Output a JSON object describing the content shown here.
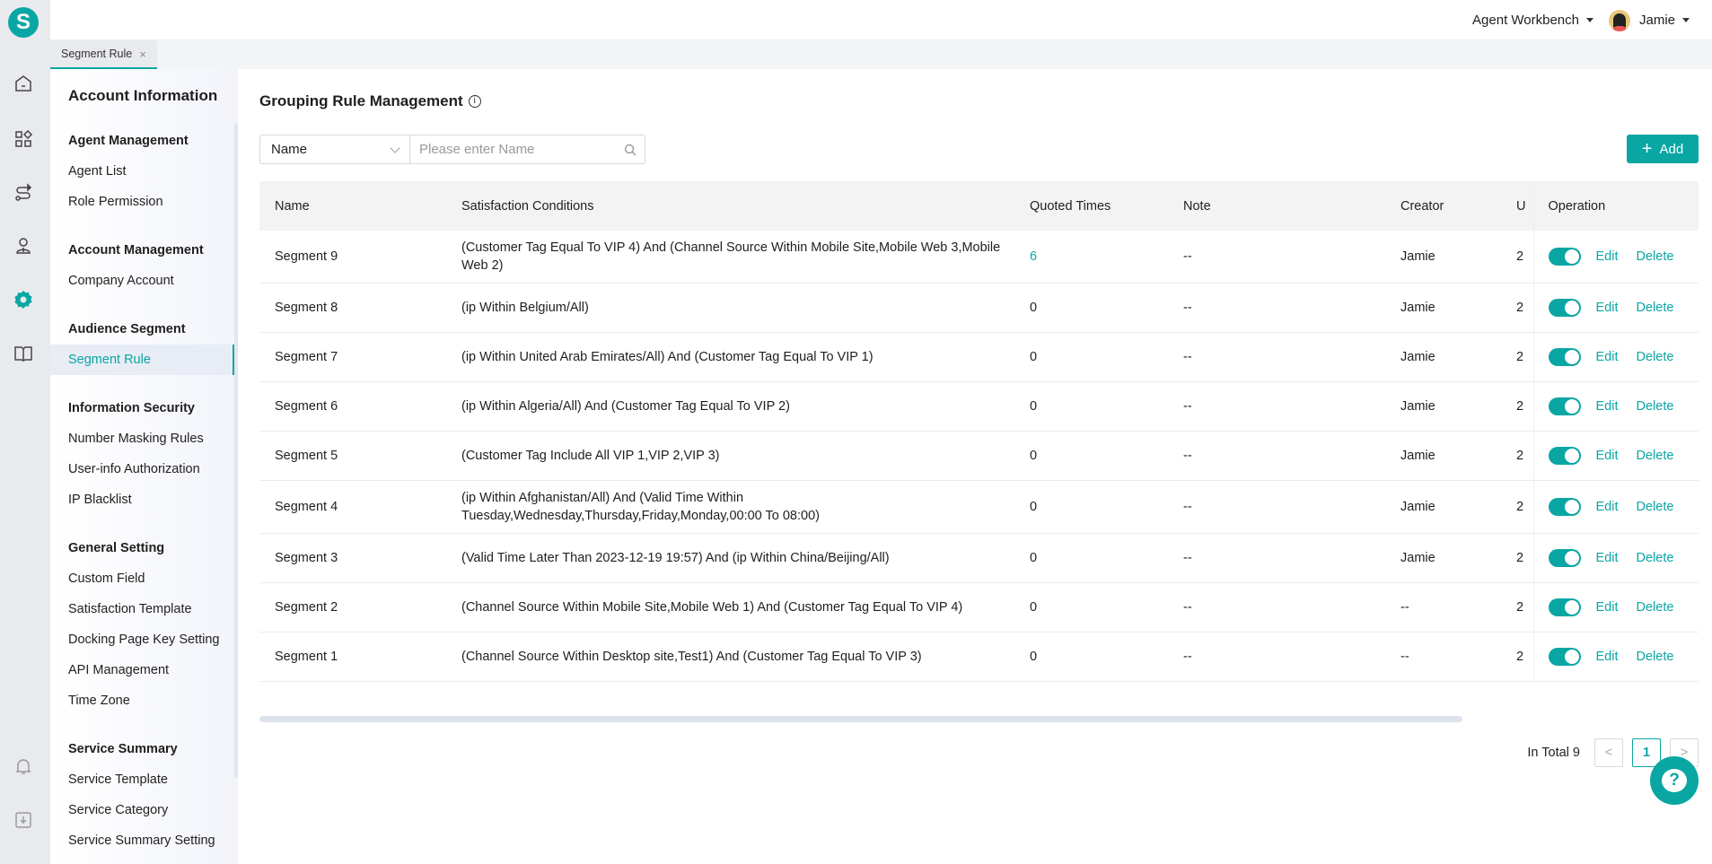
{
  "brand": {
    "logo_letter": "S",
    "accent": "#0aa6a3"
  },
  "rail": {
    "icons": [
      "home-icon",
      "apps-icon",
      "route-icon",
      "agent-icon",
      "settings-icon",
      "book-icon",
      "bell-icon",
      "download-icon"
    ],
    "active": "settings-icon"
  },
  "topbar": {
    "workbench": "Agent Workbench",
    "user": "Jamie"
  },
  "tabs": [
    {
      "label": "Segment Rule",
      "close": "×"
    }
  ],
  "sidebar": {
    "title": "Account Information",
    "groups": [
      {
        "label": "Agent Management",
        "items": [
          "Agent List",
          "Role Permission"
        ]
      },
      {
        "label": "Account Management",
        "items": [
          "Company Account"
        ]
      },
      {
        "label": "Audience Segment",
        "items": [
          "Segment Rule"
        ]
      },
      {
        "label": "Information Security",
        "items": [
          "Number Masking Rules",
          "User-info Authorization",
          "IP Blacklist"
        ]
      },
      {
        "label": "General Setting",
        "items": [
          "Custom Field",
          "Satisfaction Template",
          "Docking Page Key Setting",
          "API Management",
          "Time Zone"
        ]
      },
      {
        "label": "Service Summary",
        "items": [
          "Service Template",
          "Service Category",
          "Service Summary Setting"
        ]
      }
    ],
    "active_item": "Segment Rule"
  },
  "main": {
    "title": "Grouping Rule Management",
    "info": "i",
    "filter": {
      "field": "Name",
      "placeholder": "Please enter Name",
      "value": ""
    },
    "add_label": "Add",
    "columns": [
      "Name",
      "Satisfaction Conditions",
      "Quoted Times",
      "Note",
      "Creator",
      "U",
      "Operation"
    ],
    "rows": [
      {
        "name": "Segment 9",
        "cond": "(Customer Tag Equal To VIP 4) And (Channel Source Within Mobile Site,Mobile Web 3,Mobile Web 2)",
        "quoted": "6",
        "note": "--",
        "creator": "Jamie",
        "u": "2",
        "enabled": true
      },
      {
        "name": "Segment 8",
        "cond": "(ip Within Belgium/All)",
        "quoted": "0",
        "note": "--",
        "creator": "Jamie",
        "u": "2",
        "enabled": true
      },
      {
        "name": "Segment 7",
        "cond": "(ip Within United Arab Emirates/All) And (Customer Tag Equal To VIP 1)",
        "quoted": "0",
        "note": "--",
        "creator": "Jamie",
        "u": "2",
        "enabled": true
      },
      {
        "name": "Segment 6",
        "cond": "(ip Within Algeria/All) And (Customer Tag Equal To VIP 2)",
        "quoted": "0",
        "note": "--",
        "creator": "Jamie",
        "u": "2",
        "enabled": true
      },
      {
        "name": "Segment 5",
        "cond": "(Customer Tag Include All VIP 1,VIP 2,VIP 3)",
        "quoted": "0",
        "note": "--",
        "creator": "Jamie",
        "u": "2",
        "enabled": true
      },
      {
        "name": "Segment 4",
        "cond": "(ip Within Afghanistan/All) And (Valid Time Within Tuesday,Wednesday,Thursday,Friday,Monday,00:00 To 08:00)",
        "quoted": "0",
        "note": "--",
        "creator": "Jamie",
        "u": "2",
        "enabled": true
      },
      {
        "name": "Segment 3",
        "cond": "(Valid Time Later Than 2023-12-19 19:57) And (ip Within China/Beijing/All)",
        "quoted": "0",
        "note": "--",
        "creator": "Jamie",
        "u": "2",
        "enabled": true
      },
      {
        "name": "Segment 2",
        "cond": "(Channel Source Within Mobile Site,Mobile Web 1) And (Customer Tag Equal To VIP 4)",
        "quoted": "0",
        "note": "--",
        "creator": "--",
        "u": "2",
        "enabled": true
      },
      {
        "name": "Segment 1",
        "cond": "(Channel Source Within Desktop site,Test1) And (Customer Tag Equal To VIP 3)",
        "quoted": "0",
        "note": "--",
        "creator": "--",
        "u": "2",
        "enabled": true
      }
    ],
    "edit_label": "Edit",
    "delete_label": "Delete",
    "pagination": {
      "total_text": "In Total 9",
      "prev": "<",
      "current": "1",
      "next": ">"
    },
    "help": "?"
  }
}
